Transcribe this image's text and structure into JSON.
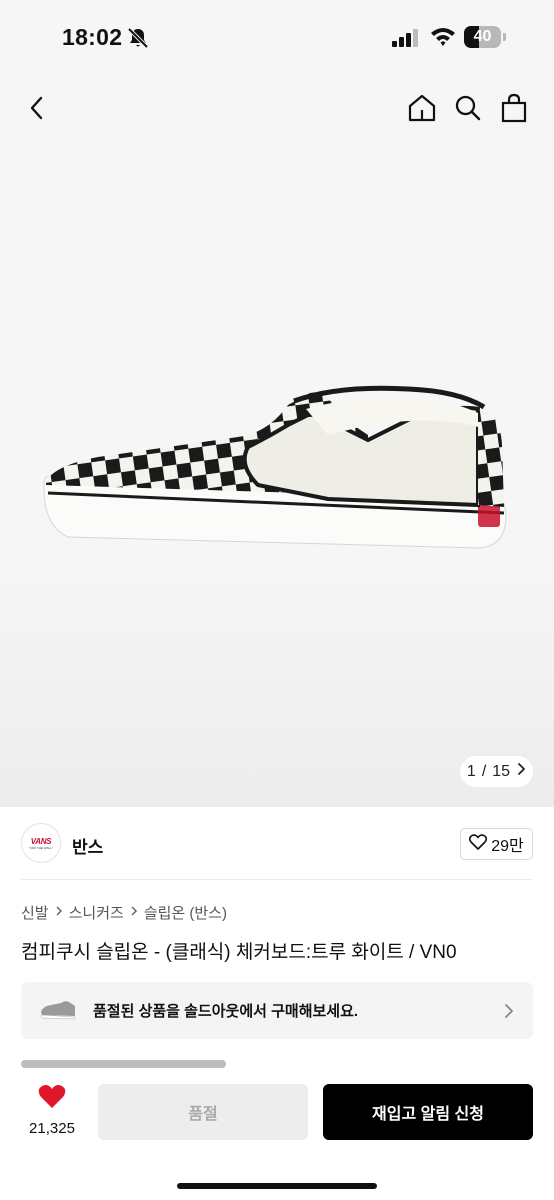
{
  "status_bar": {
    "time": "18:02",
    "battery_level": "40",
    "battery_fraction": 0.4,
    "icons": [
      "bell-slash-icon",
      "cellular-signal-icon",
      "wifi-icon",
      "battery-icon"
    ]
  },
  "nav": {
    "icons": [
      "back-arrow-icon",
      "home-icon",
      "search-icon",
      "shopping-bag-icon"
    ]
  },
  "gallery": {
    "current": "1",
    "separator": "/",
    "total": "15",
    "next_icon": "chevron-right-icon"
  },
  "brand": {
    "logo_text": "VANS",
    "logo_subtext": "\"OFF THE WALL\"",
    "name": "반스",
    "like_count": "29만",
    "like_icon": "heart-outline-icon"
  },
  "breadcrumb": [
    "신발",
    "스니커즈",
    "슬립온 (반스)"
  ],
  "product": {
    "title": "컴피쿠시 슬립온 - (클래식) 체커보드:트루 화이트 / VN0"
  },
  "outlet_banner": {
    "text": "품절된 상품을 솔드아웃에서 구매해보세요.",
    "arrow_icon": "chevron-right-icon"
  },
  "bottom_bar": {
    "wish_count": "21,325",
    "wish_icon": "heart-filled-icon",
    "soldout_label": "품절",
    "restock_label": "재입고 알림 신청"
  },
  "colors": {
    "accent_red": "#e0162b",
    "primary_button": "#000000",
    "disabled_button": "#ededed"
  }
}
